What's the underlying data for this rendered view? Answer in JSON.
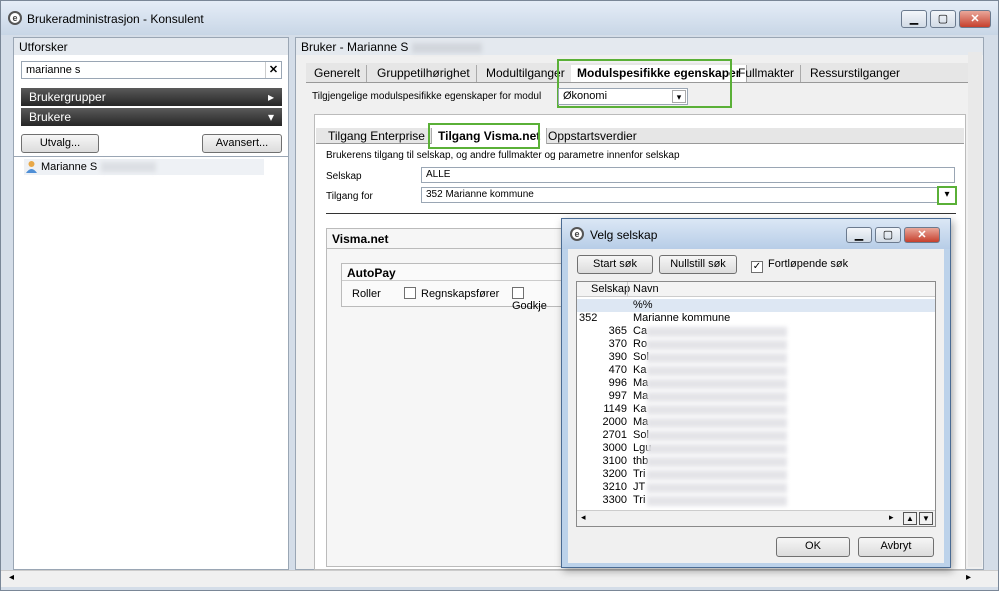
{
  "window": {
    "title": "Brukeradministrasjon - Konsulent"
  },
  "explorer": {
    "header": "Utforsker",
    "search_value": "marianne s",
    "groups": [
      {
        "label": "Brukergrupper"
      },
      {
        "label": "Brukere"
      }
    ],
    "selection_button": "Utvalg...",
    "advanced_button": "Avansert...",
    "users": [
      {
        "name": "Marianne S"
      }
    ]
  },
  "main": {
    "header": "Bruker - Marianne S",
    "tabs": [
      {
        "label": "Generelt"
      },
      {
        "label": "Gruppetilhørighet"
      },
      {
        "label": "Modultilganger"
      },
      {
        "label": "Modulspesifikke egenskaper",
        "active": true
      },
      {
        "label": "Fullmakter"
      },
      {
        "label": "Ressurstilganger"
      }
    ],
    "module_label": "Tilgjengelige modulspesifikke egenskaper for modul",
    "module_value": "Økonomi",
    "subtabs": [
      {
        "label": "Tilgang Enterprise"
      },
      {
        "label": "Tilgang Visma.net",
        "active": true
      },
      {
        "label": "Oppstartsverdier"
      }
    ],
    "description": "Brukerens tilgang til selskap, og andre fullmakter og parametre innenfor selskap",
    "selskap_label": "Selskap",
    "selskap_value": "ALLE",
    "tilgang_label": "Tilgang for",
    "tilgang_value": "352 Marianne kommune",
    "visma_section": "Visma.net",
    "autopay": {
      "header": "AutoPay",
      "roles_label": "Roller",
      "role_1": "Regnskapsfører",
      "role_2": "Godkje"
    }
  },
  "dialog": {
    "title": "Velg selskap",
    "start_button": "Start søk",
    "reset_button": "Nullstill søk",
    "continuous_label": "Fortløpende søk",
    "continuous_checked": true,
    "columns": [
      "Selskap",
      "Navn"
    ],
    "rows": [
      {
        "num": "",
        "name": "%%"
      },
      {
        "num": "352",
        "name": "Marianne kommune"
      },
      {
        "num": "365",
        "name": "Ca"
      },
      {
        "num": "370",
        "name": "Ro"
      },
      {
        "num": "390",
        "name": "Sol"
      },
      {
        "num": "470",
        "name": "Ka"
      },
      {
        "num": "996",
        "name": "Ma"
      },
      {
        "num": "997",
        "name": "Ma"
      },
      {
        "num": "1149",
        "name": "Ka"
      },
      {
        "num": "2000",
        "name": "Ma"
      },
      {
        "num": "2701",
        "name": "Sol"
      },
      {
        "num": "3000",
        "name": "Lgu"
      },
      {
        "num": "3100",
        "name": "thb"
      },
      {
        "num": "3200",
        "name": "Tri"
      },
      {
        "num": "3210",
        "name": "JT"
      },
      {
        "num": "3300",
        "name": "Tri"
      }
    ],
    "ok_button": "OK",
    "cancel_button": "Avbryt"
  },
  "colors": {
    "highlight_green": "#5ab037",
    "selected_row": "#dde7f3",
    "title_gradient": "#c8d6e6"
  }
}
